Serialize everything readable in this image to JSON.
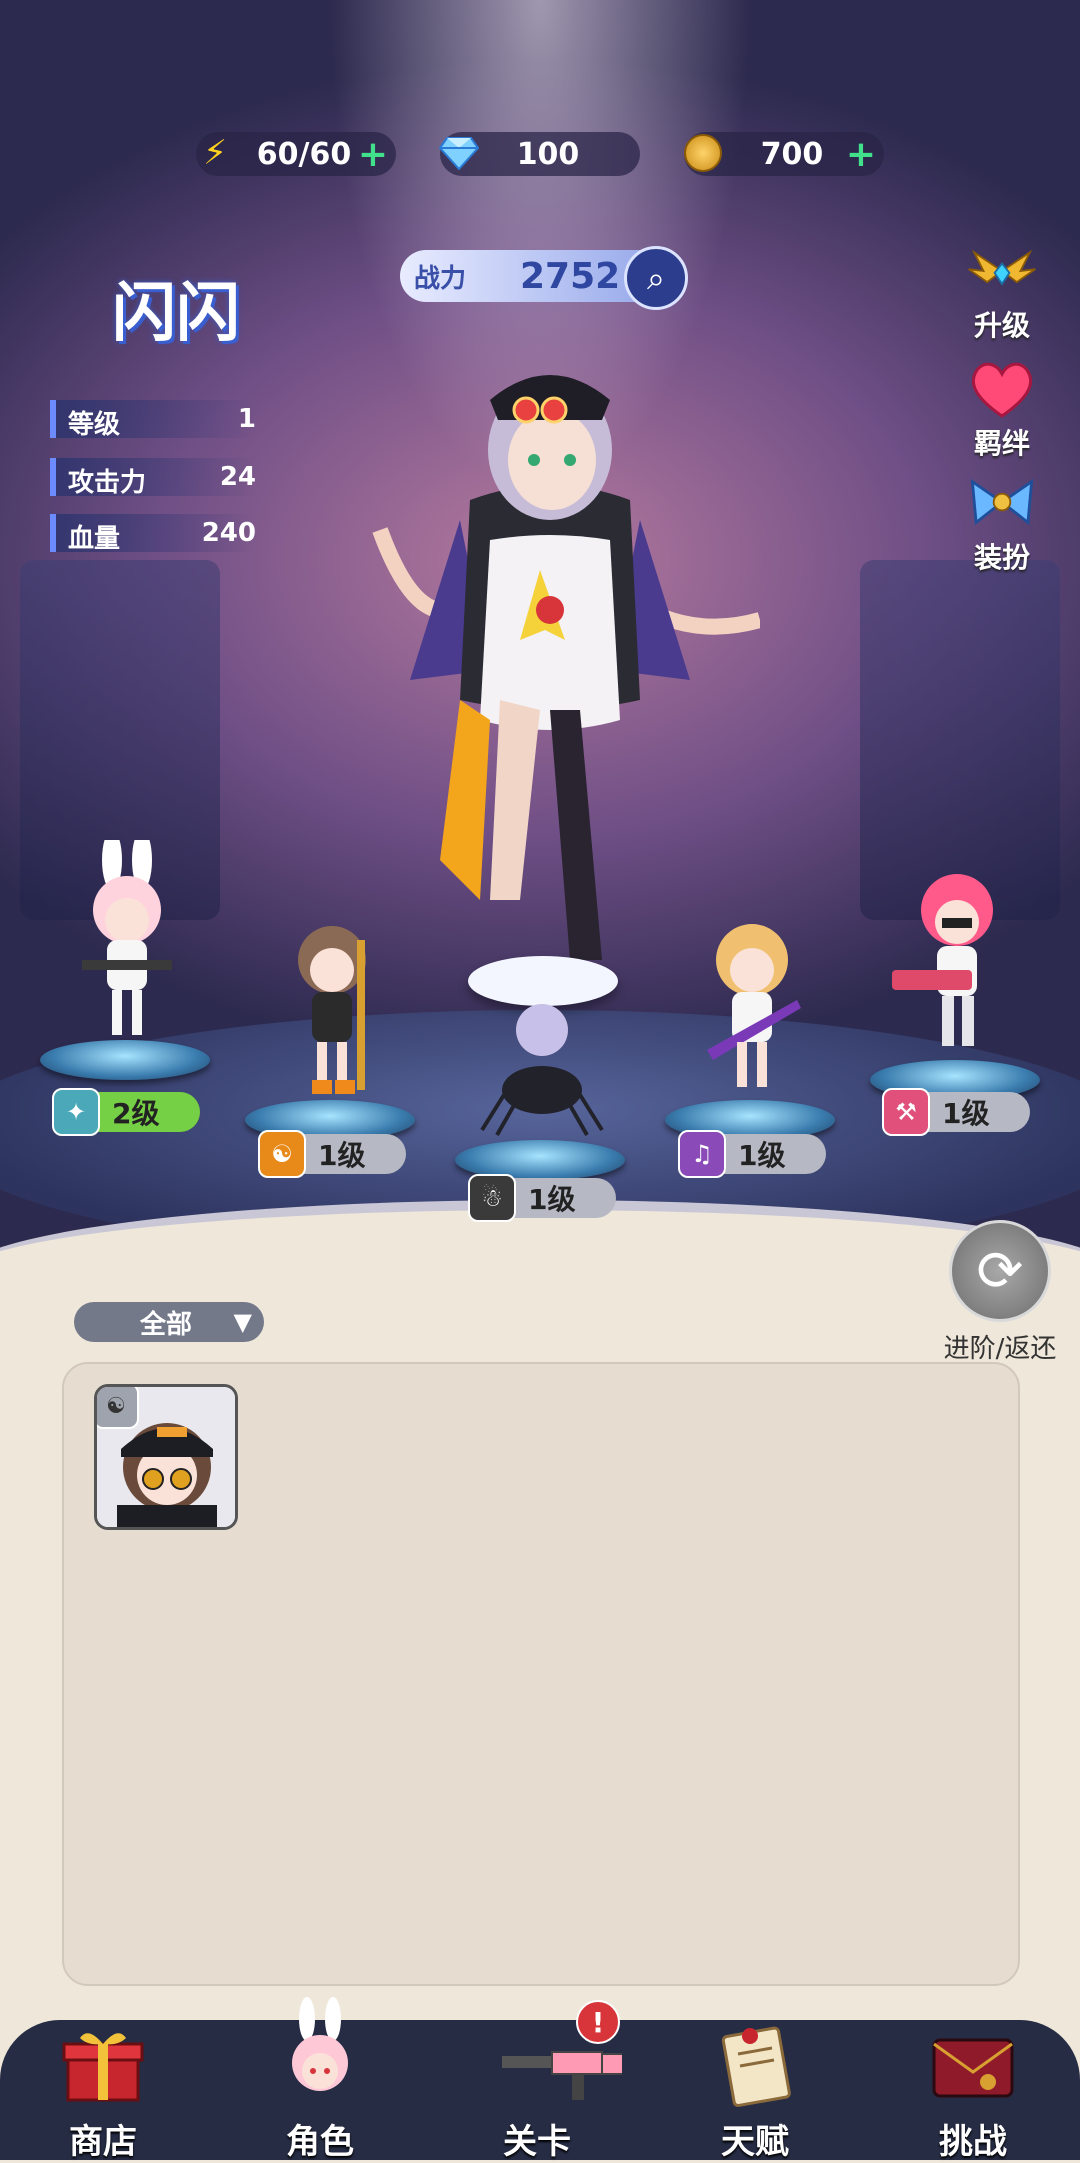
{
  "resources": {
    "energy": {
      "value": "60/60",
      "plus": "+",
      "icon": "lightning-icon"
    },
    "gems": {
      "value": "100",
      "icon": "diamond-icon"
    },
    "coins": {
      "value": "700",
      "plus": "+",
      "icon": "coin-icon"
    }
  },
  "power": {
    "label": "战力",
    "value": "2752"
  },
  "character": {
    "name": "闪闪",
    "stats": [
      {
        "label": "等级",
        "value": "1"
      },
      {
        "label": "攻击力",
        "value": "24"
      },
      {
        "label": "血量",
        "value": "240"
      }
    ]
  },
  "side_menu": {
    "upgrade": "升级",
    "bond": "羁绊",
    "dress": "装扮"
  },
  "team": [
    {
      "level": "2级",
      "icon": "rifle-icon",
      "color": "#4aa8b8",
      "highlight": true
    },
    {
      "level": "1级",
      "icon": "yin-yang-icon",
      "color": "#e88a1a"
    },
    {
      "level": "1级",
      "icon": "gingerbread-icon",
      "color": "#3a3a3a"
    },
    {
      "level": "1级",
      "icon": "guitar-icon",
      "color": "#8a4ab8"
    },
    {
      "level": "1级",
      "icon": "pickaxe-icon",
      "color": "#e0507a"
    }
  ],
  "evolve": {
    "label": "进阶/返还"
  },
  "filter": {
    "label": "全部"
  },
  "nav": {
    "shop": "商店",
    "hero": "角色",
    "stage": "关卡",
    "talent": "天赋",
    "challenge": "挑战",
    "stage_alert": "!"
  },
  "colors": {
    "accent": "#3a5fd0",
    "nav_bg": "#262c44",
    "panel_bg": "#e6ddd0"
  }
}
